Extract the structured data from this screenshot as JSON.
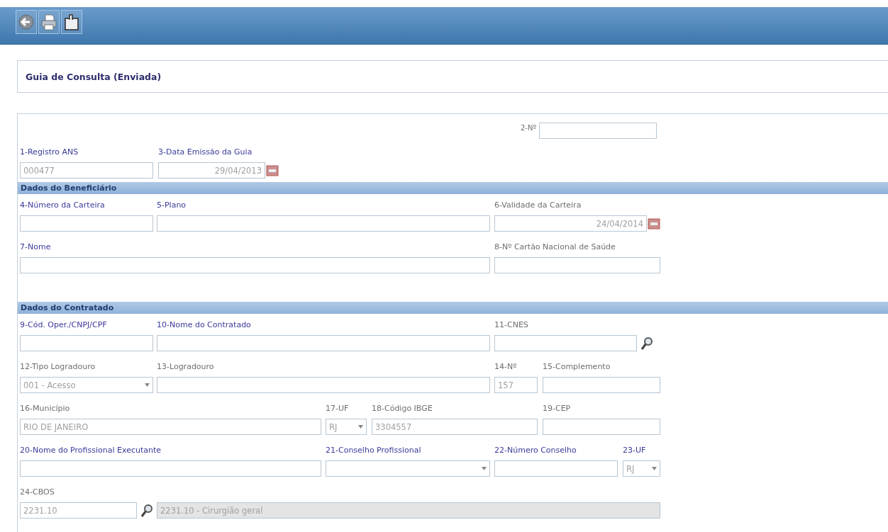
{
  "toolbar": {
    "buttons": [
      {
        "kind": "back"
      },
      {
        "kind": "print"
      },
      {
        "kind": "document"
      }
    ]
  },
  "title": "Guia de Consulta (Enviada)",
  "form": {
    "top_rows": [
      {
        "fields": [
          {
            "kind": "inline",
            "label": "2-Nº",
            "required": false
          }
        ]
      },
      {
        "fields": [
          {
            "kind": "text",
            "label": "1-Registro ANS",
            "required": true,
            "value": "000477"
          },
          {
            "kind": "date",
            "label": "3-Data Emissão da Guia",
            "required": true,
            "value": "29/04/2013"
          }
        ]
      }
    ],
    "sections": [
      {
        "title": "Dados do Beneficiário",
        "rows": [
          {
            "fields": [
              {
                "kind": "text",
                "label": "4-Número da Carteira",
                "required": true
              },
              {
                "kind": "text",
                "label": "5-Plano",
                "required": true
              },
              {
                "kind": "date",
                "label": "6-Validade da Carteira",
                "required": false,
                "value": "24/04/2014"
              }
            ]
          },
          {
            "fields": [
              {
                "kind": "text",
                "label": "7-Nome",
                "required": true
              },
              {
                "kind": "text",
                "label": "8-Nº Cartão Nacional de Saúde",
                "required": false
              }
            ]
          }
        ]
      },
      {
        "title": "Dados do Contratado",
        "rows": [
          {
            "fields": [
              {
                "kind": "text",
                "label": "9-Cód. Oper./CNPJ/CPF",
                "required": true
              },
              {
                "kind": "text",
                "label": "10-Nome do Contratado",
                "required": true
              },
              {
                "kind": "lookup",
                "label": "11-CNES",
                "required": false
              }
            ]
          },
          {
            "fields": [
              {
                "kind": "select",
                "label": "12-Tipo Logradouro",
                "required": false,
                "value": "001 - Acesso"
              },
              {
                "kind": "text",
                "label": "13-Logradouro",
                "required": false
              },
              {
                "kind": "text",
                "label": "14-Nº",
                "required": false,
                "value": "157"
              },
              {
                "kind": "text",
                "label": "15-Complemento",
                "required": false
              }
            ]
          },
          {
            "fields": [
              {
                "kind": "text",
                "label": "16-Município",
                "required": false,
                "value": "RIO DE JANEIRO"
              },
              {
                "kind": "select",
                "label": "17-UF",
                "required": false,
                "value": "RJ"
              },
              {
                "kind": "text",
                "label": "18-Código IBGE",
                "required": false,
                "value": "3304557"
              },
              {
                "kind": "text",
                "label": "19-CEP",
                "required": false
              }
            ]
          },
          {
            "fields": [
              {
                "kind": "text",
                "label": "20-Nome do Profissional Executante",
                "required": true
              },
              {
                "kind": "select",
                "label": "21-Conselho Profissional",
                "required": true
              },
              {
                "kind": "text",
                "label": "22-Número Conselho",
                "required": true
              },
              {
                "kind": "select",
                "label": "23-UF",
                "required": true,
                "value": "RJ"
              }
            ]
          },
          {
            "fields": [
              {
                "kind": "lookup",
                "label": "24-CBOS",
                "required": false,
                "value": "2231.10"
              },
              {
                "kind": "readonly",
                "value": "2231.10 - Cirurgião geral"
              }
            ]
          }
        ]
      }
    ]
  }
}
